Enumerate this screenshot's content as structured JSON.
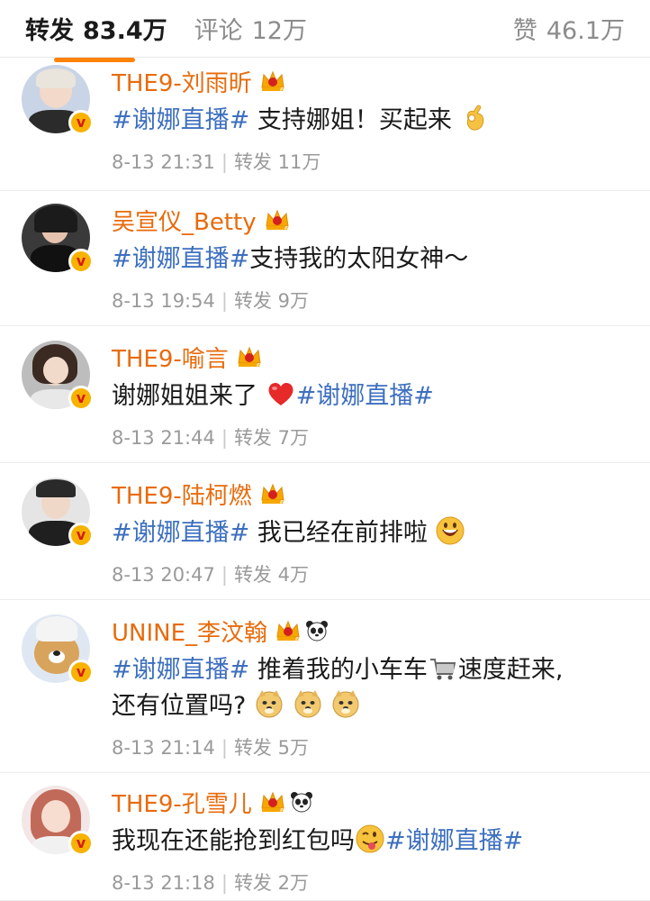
{
  "tabs": {
    "repost": {
      "label": "转发",
      "count": "83.4万"
    },
    "comment": {
      "label": "评论",
      "count": "12万"
    },
    "like": {
      "label": "赞",
      "count": "46.1万"
    }
  },
  "posts": [
    {
      "name": "THE9-刘雨昕",
      "tag": "#谢娜直播#",
      "text_after": " 支持娜姐！买起来",
      "emoji": "ok-hand",
      "time": "8-13 21:31",
      "repost_label": "转发",
      "repost_count": "11万"
    },
    {
      "name": "吴宣仪_Betty",
      "tag": "#谢娜直播#",
      "text_after": "支持我的太阳女神～",
      "time": "8-13 19:54",
      "repost_label": "转发",
      "repost_count": "9万"
    },
    {
      "name": "THE9-喻言",
      "text_before": "谢娜姐姐来了",
      "emoji": "red-heart",
      "tag": "#谢娜直播#",
      "time": "8-13 21:44",
      "repost_label": "转发",
      "repost_count": "7万"
    },
    {
      "name": "THE9-陆柯燃",
      "tag": "#谢娜直播#",
      "text_after": " 我已经在前排啦",
      "emoji": "grinning-face",
      "time": "8-13 20:47",
      "repost_label": "转发",
      "repost_count": "4万"
    },
    {
      "name": "UNINE_李汶翰",
      "tag": "#谢娜直播#",
      "text_after": " 推着我的小车车",
      "text_after2": "速度赶来,",
      "text_line2": "还有位置吗?",
      "emoji": "shopping-cart",
      "time": "8-13 21:14",
      "repost_label": "转发",
      "repost_count": "5万"
    },
    {
      "name": "THE9-孔雪儿",
      "text_before": "我现在还能抢到红包吗",
      "emoji": "winking-tongue-face",
      "tag": "#谢娜直播#",
      "time": "8-13 21:18",
      "repost_label": "转发",
      "repost_count": "2万"
    }
  ],
  "colors": {
    "name": "#e86b0c",
    "topic": "#3d6fbf",
    "active_tab_underline": "#ff8200",
    "meta": "#9a9a9a"
  }
}
